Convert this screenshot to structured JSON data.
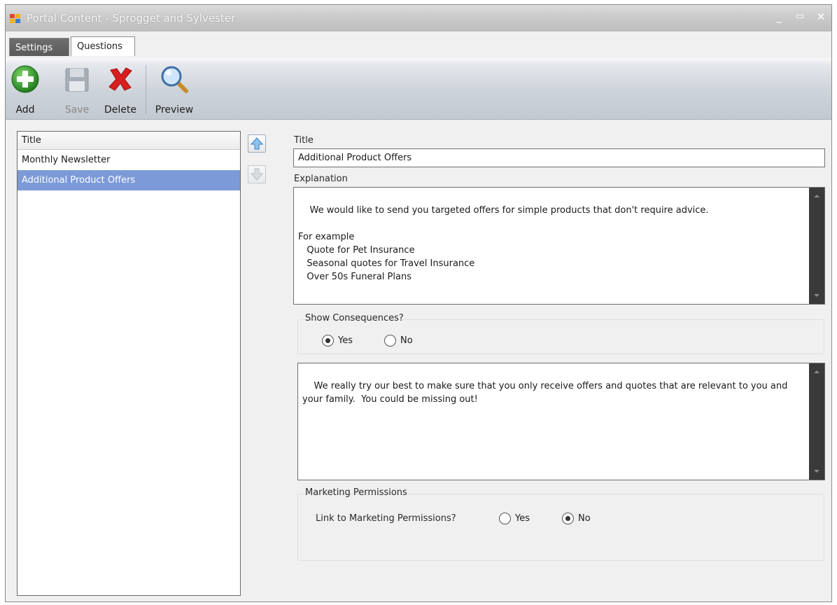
{
  "window": {
    "title": "Portal Content - Sprogget and Sylvester",
    "controls": {
      "minimize": "_",
      "maximize": "▭",
      "close": "✕"
    }
  },
  "tabs": [
    {
      "label": "Settings",
      "active": false
    },
    {
      "label": "Questions",
      "active": true
    }
  ],
  "toolbar": {
    "add_label": "Add",
    "save_label": "Save",
    "delete_label": "Delete",
    "preview_label": "Preview",
    "save_enabled": false
  },
  "list": {
    "header": "Title",
    "items": [
      {
        "label": "Monthly Newsletter",
        "selected": false
      },
      {
        "label": "Additional Product Offers",
        "selected": true
      }
    ]
  },
  "form": {
    "title_label": "Title",
    "title_value": "Additional Product Offers",
    "explanation_label": "Explanation",
    "explanation_value": "We would like to send you targeted offers for simple products that don't require advice.\n\nFor example\n   Quote for Pet Insurance\n   Seasonal quotes for Travel Insurance\n   Over 50s Funeral Plans",
    "show_consequences": {
      "label": "Show Consequences?",
      "yes_label": "Yes",
      "no_label": "No",
      "selected": "Yes"
    },
    "consequences_value": "We really try our best to make sure that you only receive offers and quotes that are relevant to you and your family.  You could be missing out!",
    "marketing": {
      "group_label": "Marketing Permissions",
      "link_label": "Link to Marketing Permissions?",
      "yes_label": "Yes",
      "no_label": "No",
      "selected": "No"
    }
  },
  "colors": {
    "selection": "#7c9ad8",
    "add_green": "#2f9a2a",
    "delete_red": "#d81e1e"
  }
}
